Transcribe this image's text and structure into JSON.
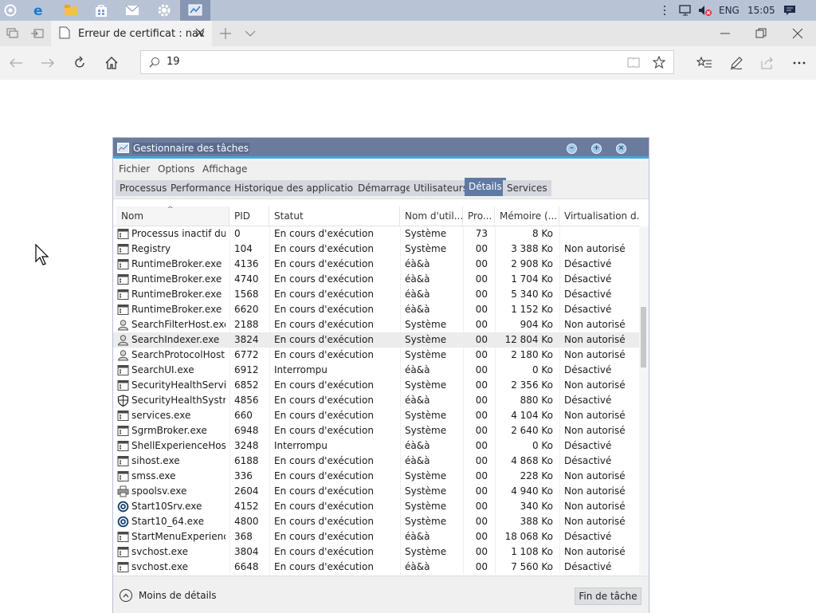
{
  "taskbar": {
    "tray_language": "ENG",
    "tray_time": "15:05"
  },
  "browser": {
    "tab_title": "Erreur de certificat : nav",
    "address": "19"
  },
  "taskmanager": {
    "title": "Gestionnaire des tâches",
    "menu": [
      "Fichier",
      "Options",
      "Affichage"
    ],
    "tabs": [
      "Processus",
      "Performance",
      "Historique des applications",
      "Démarrage",
      "Utilisateurs",
      "Détails",
      "Services"
    ],
    "selected_tab": "Détails",
    "columns": [
      "Nom",
      "PID",
      "Statut",
      "Nom d'util...",
      "Pro...",
      "Mémoire (...",
      "Virtualisation d..."
    ],
    "sort_column": "Nom",
    "rows": [
      {
        "icon": "window-process-icon",
        "name": "Processus inactif du ...",
        "pid": "0",
        "status": "En cours d'exécution",
        "user": "Système",
        "cpu": "73",
        "mem": "8 Ko",
        "virt": ""
      },
      {
        "icon": "window-process-icon",
        "name": "Registry",
        "pid": "104",
        "status": "En cours d'exécution",
        "user": "Système",
        "cpu": "00",
        "mem": "3 388 Ko",
        "virt": "Non autorisé"
      },
      {
        "icon": "window-process-icon",
        "name": "RuntimeBroker.exe",
        "pid": "4136",
        "status": "En cours d'exécution",
        "user": "éà&à",
        "cpu": "00",
        "mem": "2 908 Ko",
        "virt": "Désactivé"
      },
      {
        "icon": "window-process-icon",
        "name": "RuntimeBroker.exe",
        "pid": "4740",
        "status": "En cours d'exécution",
        "user": "éà&à",
        "cpu": "00",
        "mem": "1 704 Ko",
        "virt": "Désactivé"
      },
      {
        "icon": "window-process-icon",
        "name": "RuntimeBroker.exe",
        "pid": "1568",
        "status": "En cours d'exécution",
        "user": "éà&à",
        "cpu": "00",
        "mem": "5 340 Ko",
        "virt": "Désactivé"
      },
      {
        "icon": "window-process-icon",
        "name": "RuntimeBroker.exe",
        "pid": "6620",
        "status": "En cours d'exécution",
        "user": "éà&à",
        "cpu": "00",
        "mem": "1 152 Ko",
        "virt": "Désactivé"
      },
      {
        "icon": "search-user-icon",
        "name": "SearchFilterHost.exe",
        "pid": "2188",
        "status": "En cours d'exécution",
        "user": "Système",
        "cpu": "00",
        "mem": "904 Ko",
        "virt": "Non autorisé"
      },
      {
        "icon": "search-user-icon",
        "name": "SearchIndexer.exe",
        "pid": "3824",
        "status": "En cours d'exécution",
        "user": "Système",
        "cpu": "00",
        "mem": "12 804 Ko",
        "virt": "Non autorisé",
        "highlight": true
      },
      {
        "icon": "search-user-icon",
        "name": "SearchProtocolHost....",
        "pid": "6772",
        "status": "En cours d'exécution",
        "user": "Système",
        "cpu": "00",
        "mem": "2 180 Ko",
        "virt": "Non autorisé"
      },
      {
        "icon": "window-process-icon",
        "name": "SearchUI.exe",
        "pid": "6912",
        "status": "Interrompu",
        "user": "éà&à",
        "cpu": "00",
        "mem": "0 Ko",
        "virt": "Désactivé"
      },
      {
        "icon": "window-process-icon",
        "name": "SecurityHealthServic...",
        "pid": "6852",
        "status": "En cours d'exécution",
        "user": "Système",
        "cpu": "00",
        "mem": "2 356 Ko",
        "virt": "Non autorisé"
      },
      {
        "icon": "shield-icon",
        "name": "SecurityHealthSystra...",
        "pid": "4856",
        "status": "En cours d'exécution",
        "user": "éà&à",
        "cpu": "00",
        "mem": "880 Ko",
        "virt": "Désactivé"
      },
      {
        "icon": "window-process-icon",
        "name": "services.exe",
        "pid": "660",
        "status": "En cours d'exécution",
        "user": "Système",
        "cpu": "00",
        "mem": "4 104 Ko",
        "virt": "Non autorisé"
      },
      {
        "icon": "window-process-icon",
        "name": "SgrmBroker.exe",
        "pid": "6948",
        "status": "En cours d'exécution",
        "user": "Système",
        "cpu": "00",
        "mem": "2 640 Ko",
        "virt": "Non autorisé"
      },
      {
        "icon": "window-process-icon",
        "name": "ShellExperienceHost....",
        "pid": "3248",
        "status": "Interrompu",
        "user": "éà&à",
        "cpu": "00",
        "mem": "0 Ko",
        "virt": "Désactivé"
      },
      {
        "icon": "window-process-icon",
        "name": "sihost.exe",
        "pid": "6188",
        "status": "En cours d'exécution",
        "user": "éà&à",
        "cpu": "00",
        "mem": "4 868 Ko",
        "virt": "Désactivé"
      },
      {
        "icon": "window-process-icon",
        "name": "smss.exe",
        "pid": "336",
        "status": "En cours d'exécution",
        "user": "Système",
        "cpu": "00",
        "mem": "228 Ko",
        "virt": "Non autorisé"
      },
      {
        "icon": "printer-icon",
        "name": "spoolsv.exe",
        "pid": "2604",
        "status": "En cours d'exécution",
        "user": "Système",
        "cpu": "00",
        "mem": "4 940 Ko",
        "virt": "Non autorisé"
      },
      {
        "icon": "circle-logo-icon",
        "name": "Start10Srv.exe",
        "pid": "4152",
        "status": "En cours d'exécution",
        "user": "Système",
        "cpu": "00",
        "mem": "340 Ko",
        "virt": "Non autorisé"
      },
      {
        "icon": "circle-logo-icon",
        "name": "Start10_64.exe",
        "pid": "4800",
        "status": "En cours d'exécution",
        "user": "Système",
        "cpu": "00",
        "mem": "388 Ko",
        "virt": "Non autorisé"
      },
      {
        "icon": "window-process-icon",
        "name": "StartMenuExperienc...",
        "pid": "368",
        "status": "En cours d'exécution",
        "user": "éà&à",
        "cpu": "00",
        "mem": "18 068 Ko",
        "virt": "Désactivé"
      },
      {
        "icon": "window-process-icon",
        "name": "svchost.exe",
        "pid": "3804",
        "status": "En cours d'exécution",
        "user": "Système",
        "cpu": "00",
        "mem": "1 108 Ko",
        "virt": "Non autorisé"
      },
      {
        "icon": "window-process-icon",
        "name": "svchost.exe",
        "pid": "6648",
        "status": "En cours d'exécution",
        "user": "éà&à",
        "cpu": "00",
        "mem": "7 560 Ko",
        "virt": "Désactivé"
      }
    ],
    "scroll_position": 0.38,
    "fewer_details": "Moins de détails",
    "end_task": "Fin de tâche"
  }
}
